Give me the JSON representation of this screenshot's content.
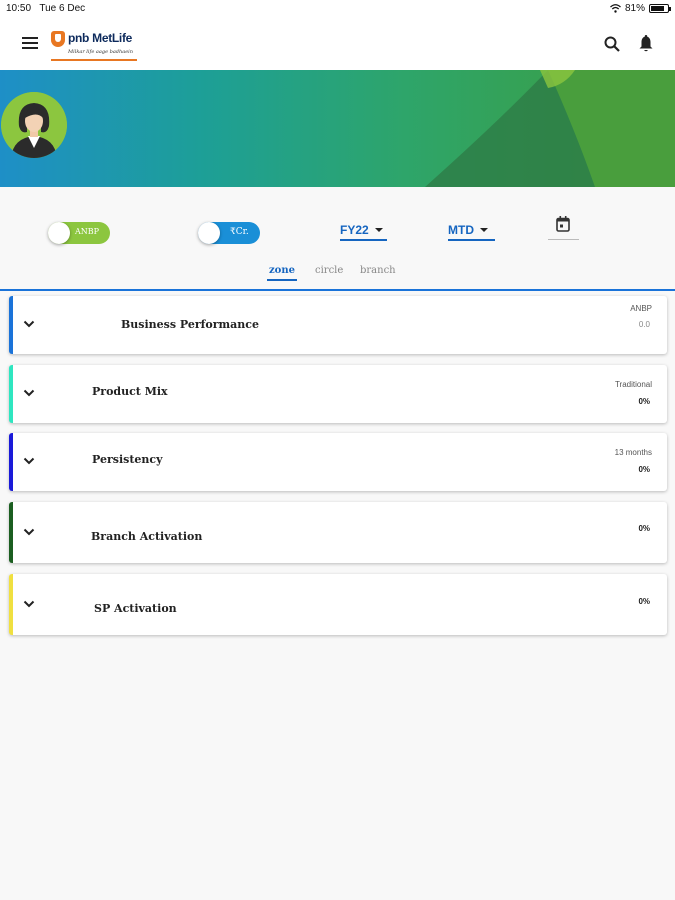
{
  "status_bar": {
    "time": "10:50",
    "date": "Tue 6 Dec",
    "battery": "81%",
    "battery_level": 0.81
  },
  "app_bar": {
    "logo_text": "pnb MetLife",
    "logo_tagline": "Milkar life aage badhaein",
    "icons": [
      "menu-icon",
      "search-icon",
      "bell-icon"
    ]
  },
  "filters": {
    "toggle_anbp": {
      "label": "ANBP",
      "color": "#8cc63f"
    },
    "toggle_currency": {
      "label": "₹Cr.",
      "color": "#1a8fd7"
    },
    "fiscal_year": "FY22",
    "period": "MTD",
    "calendar_icon": "calendar-icon"
  },
  "tabs": [
    {
      "label": "zone",
      "active": true
    },
    {
      "label": "circle",
      "active": false
    },
    {
      "label": "branch",
      "active": false
    }
  ],
  "cards": [
    {
      "title": "Business Performance",
      "metric_label": "ANBP",
      "metric_value": "0.0",
      "accent": "#1a73d9"
    },
    {
      "title": "Product Mix",
      "metric_label": "Traditional",
      "metric_value": "0%",
      "accent": "#2ee6c0"
    },
    {
      "title": "Persistency",
      "metric_label": "13 months",
      "metric_value": "0%",
      "accent": "#1a1ad9"
    },
    {
      "title": "Branch Activation",
      "metric_label": "",
      "metric_value": "0%",
      "accent": "#1b5e20"
    },
    {
      "title": "SP Activation",
      "metric_label": "",
      "metric_value": "0%",
      "accent": "#f0e040"
    }
  ]
}
